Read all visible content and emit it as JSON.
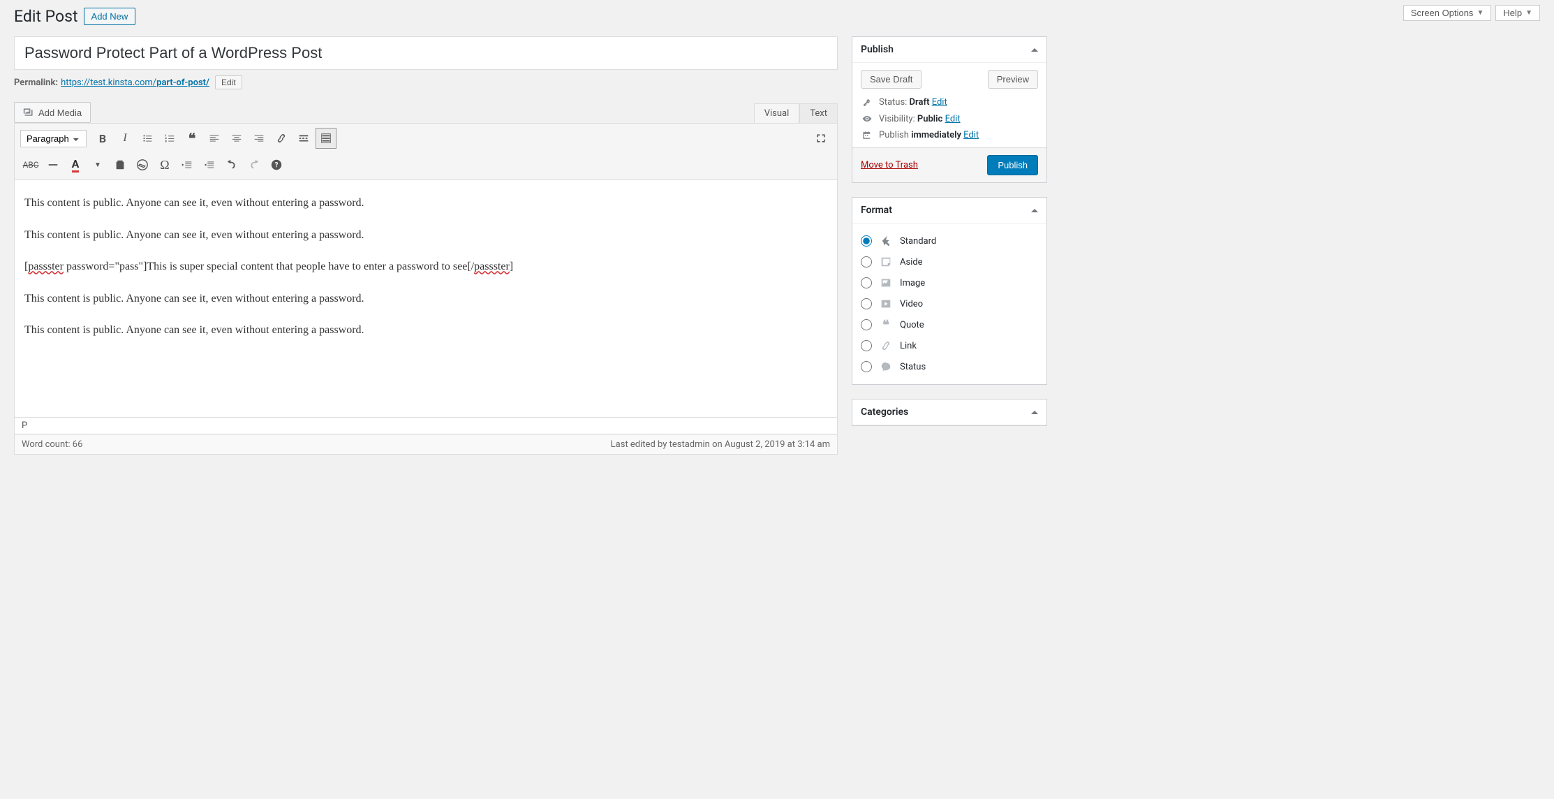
{
  "topButtons": {
    "screenOptions": "Screen Options",
    "help": "Help"
  },
  "header": {
    "pageTitle": "Edit Post",
    "addNew": "Add New"
  },
  "post": {
    "title": "Password Protect Part of a WordPress Post",
    "permalinkLabel": "Permalink:",
    "permalinkBase": "https://test.kinsta.com/",
    "permalinkSlug": "part-of-post/",
    "editSlug": "Edit"
  },
  "editor": {
    "addMedia": "Add Media",
    "tabs": {
      "visual": "Visual",
      "text": "Text"
    },
    "formatSelect": "Paragraph",
    "content": {
      "p1": "This content is public. Anyone can see it, even without entering a password.",
      "p2": "This content is public. Anyone can see it, even without entering a password.",
      "p3a": "[",
      "p3b": "passster",
      "p3c": " password=\"pass\"]This is super special content that people have to enter a password to see[/",
      "p3d": "passster",
      "p3e": "]",
      "p4": "This content is public. Anyone can see it, even without entering a password.",
      "p5": "This content is public. Anyone can see it, even without entering a password."
    },
    "pathBar": "P",
    "wordCount": "Word count: 66",
    "lastEdited": "Last edited by testadmin on August 2, 2019 at 3:14 am"
  },
  "publish": {
    "title": "Publish",
    "saveDraft": "Save Draft",
    "preview": "Preview",
    "statusLabel": "Status: ",
    "statusValue": "Draft",
    "visibilityLabel": "Visibility: ",
    "visibilityValue": "Public",
    "publishDateLabel": "Publish ",
    "publishDateValue": "immediately",
    "edit": "Edit",
    "trash": "Move to Trash",
    "publishBtn": "Publish"
  },
  "format": {
    "title": "Format",
    "items": [
      {
        "label": "Standard",
        "checked": true
      },
      {
        "label": "Aside",
        "checked": false
      },
      {
        "label": "Image",
        "checked": false
      },
      {
        "label": "Video",
        "checked": false
      },
      {
        "label": "Quote",
        "checked": false
      },
      {
        "label": "Link",
        "checked": false
      },
      {
        "label": "Status",
        "checked": false
      }
    ]
  },
  "categories": {
    "title": "Categories"
  }
}
